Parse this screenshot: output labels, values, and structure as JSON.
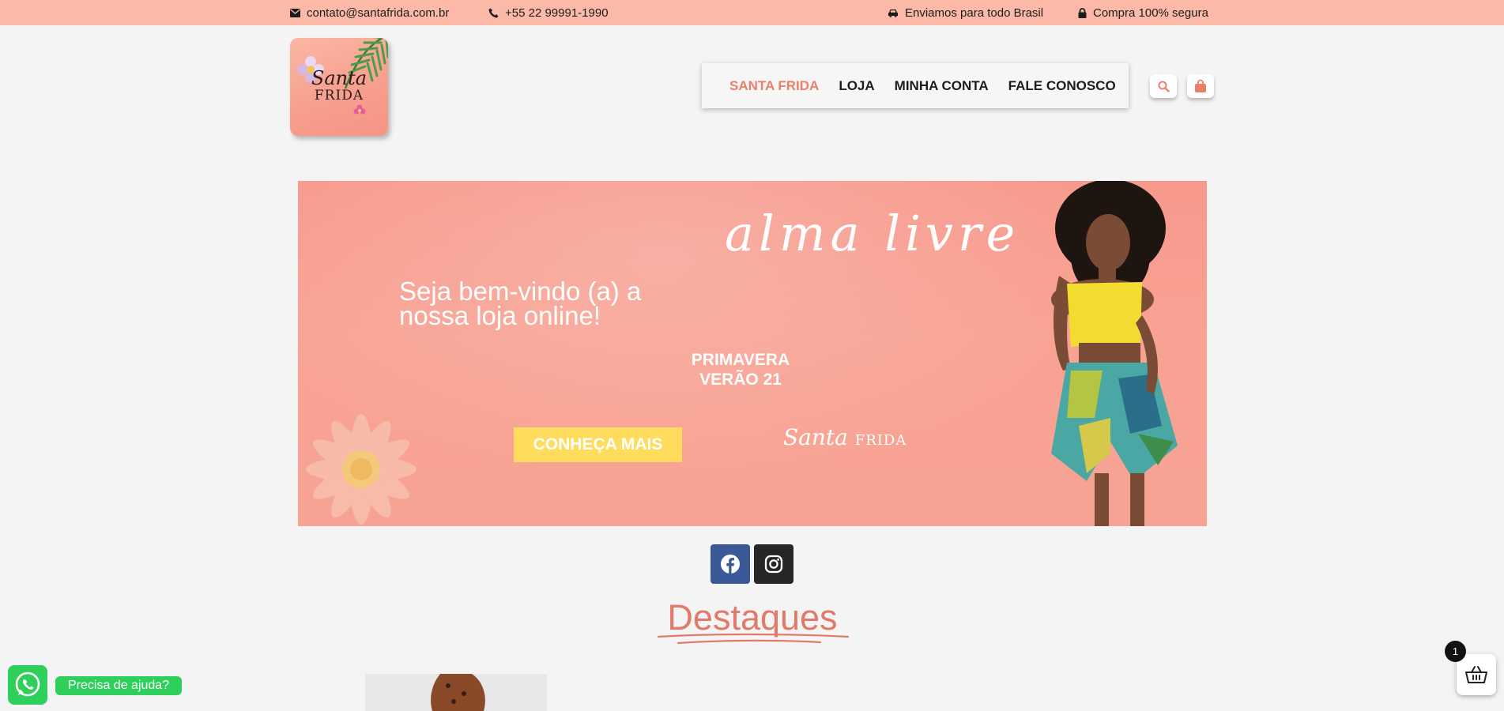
{
  "topbar": {
    "email": "contato@santafrida.com.br",
    "phone": "+55 22 99991-1990",
    "shipping": "Enviamos para todo Brasil",
    "secure": "Compra 100% segura"
  },
  "logo": {
    "line1": "Santa",
    "line2": "FRIDA"
  },
  "nav": {
    "items": [
      "SANTA FRIDA",
      "LOJA",
      "MINHA CONTA",
      "FALE CONOSCO"
    ],
    "active_color": "#ea7f6b"
  },
  "header_icons": [
    "search-icon",
    "shopping-bag-icon"
  ],
  "banner": {
    "script_text": "alma livre",
    "welcome": "Seja bem-vindo (a) a nossa loja online!",
    "season_line1": "PRIMAVERA",
    "season_line2": "VERÃO 21",
    "cta": "CONHEÇA MAIS",
    "brand_script": "Santa",
    "brand_caps": "FRIDA"
  },
  "social": [
    "facebook-icon",
    "instagram-icon"
  ],
  "section_title": "Destaques",
  "whatsapp": {
    "label": "Precisa de ajuda?"
  },
  "cart": {
    "count": "1"
  },
  "colors": {
    "topbar": "#fdb9a8",
    "accent": "#e17a6a",
    "cta": "#ffdc5c",
    "whatsapp": "#2ecf5a",
    "facebook": "#3b5998"
  }
}
